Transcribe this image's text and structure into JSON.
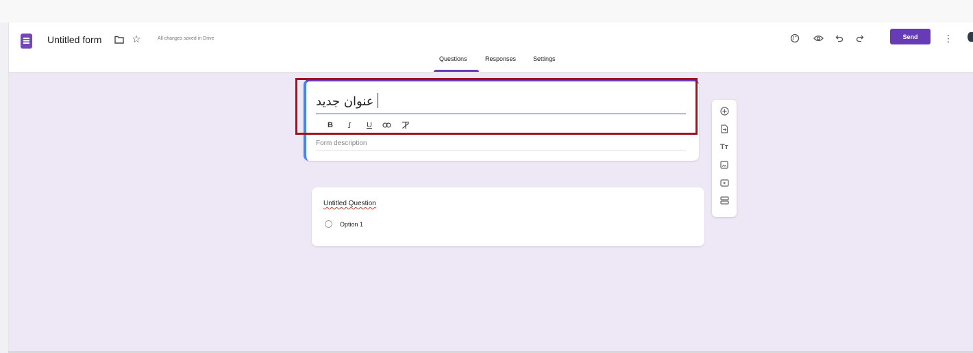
{
  "header": {
    "doc_title": "Untitled form",
    "save_status": "All changes saved in Drive",
    "send_label": "Send",
    "icons": [
      "forms-logo-icon",
      "folder-icon",
      "star-icon",
      "palette-icon",
      "preview-eye-icon",
      "undo-icon",
      "redo-icon",
      "more-vert-icon"
    ]
  },
  "tabs": {
    "questions": "Questions",
    "responses": "Responses",
    "settings": "Settings",
    "active": "Questions"
  },
  "title_card": {
    "title_value": "عنوان جديد",
    "description_placeholder": "Form description",
    "format_buttons": {
      "bold": "B",
      "italic": "I",
      "underline": "U",
      "link_icon": "link-icon",
      "clear_format_icon": "clear-format-icon"
    }
  },
  "question_card": {
    "question_title": "Untitled Question",
    "option_label": "Option 1"
  },
  "side_toolbar": {
    "title_glyph": "Tт",
    "icons": [
      "add-question-icon",
      "import-questions-icon",
      "add-title-icon",
      "add-image-icon",
      "add-video-icon",
      "add-section-icon"
    ]
  },
  "colors": {
    "accent": "#673ab7",
    "background": "#ede7f6",
    "highlight": "#a0101f",
    "title_card_left_bar": "#4285f4"
  }
}
